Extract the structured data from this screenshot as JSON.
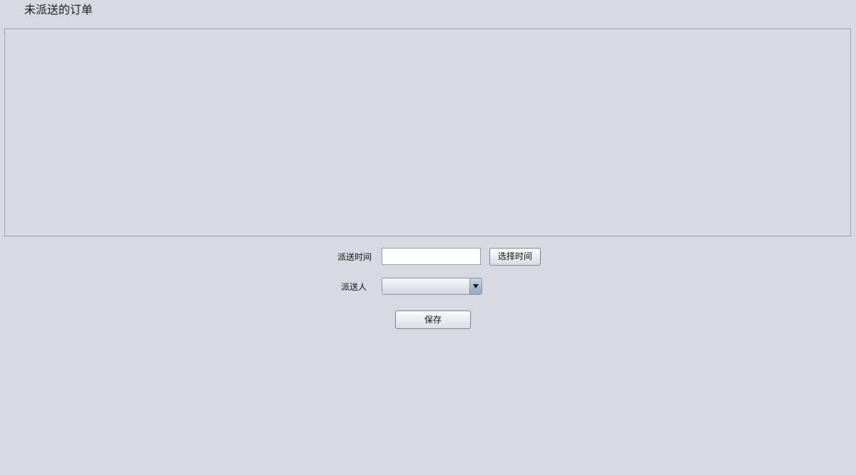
{
  "header": {
    "title": "未派送的订单"
  },
  "orders_panel": {
    "rows": []
  },
  "form": {
    "time_label": "派送时间",
    "time_value": "",
    "pick_time_button": "选择时间",
    "person_label": "派送人",
    "person_selected": "",
    "save_button": "保存"
  },
  "icons": {
    "dropdown": "chevron-down-icon"
  }
}
